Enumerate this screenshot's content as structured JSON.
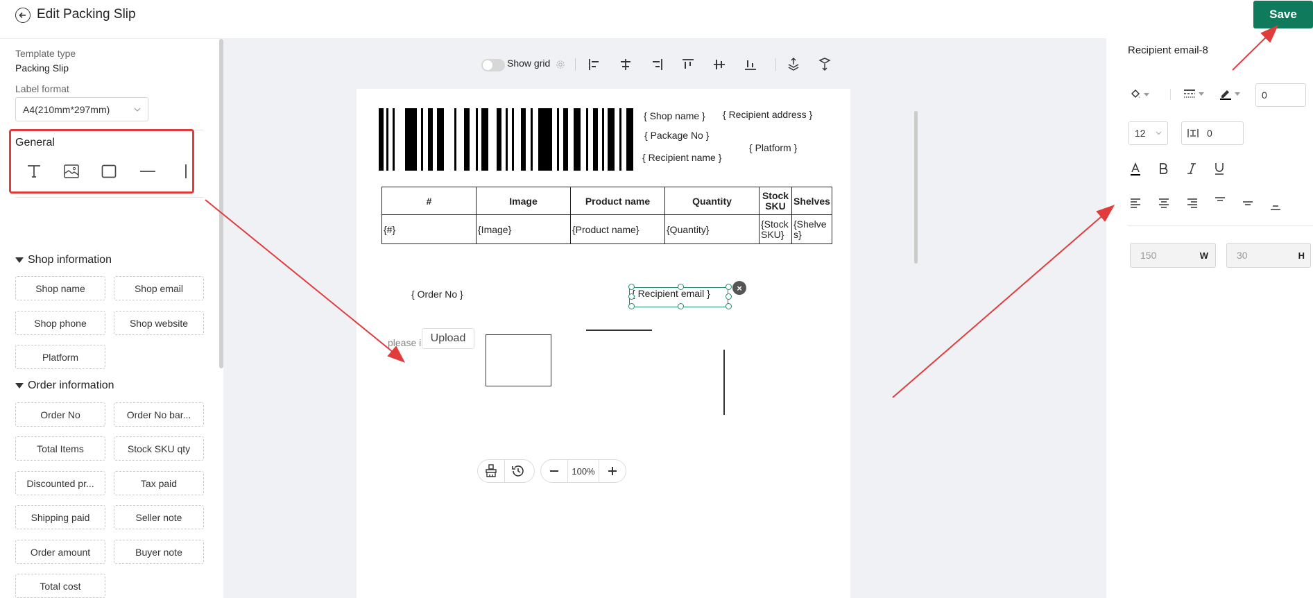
{
  "header": {
    "back_icon": "arrow-left-icon",
    "title": "Edit Packing Slip",
    "save_label": "Save",
    "save_color": "#0f7a5c"
  },
  "left_panel": {
    "template_type_label": "Template type",
    "template_type_value": "Packing Slip",
    "label_format_label": "Label format",
    "label_format_value": "A4(210mm*297mm)",
    "general": {
      "title": "General",
      "tools": [
        "text-tool-icon",
        "image-tool-icon",
        "rectangle-tool-icon",
        "horizontal-line-tool-icon",
        "vertical-line-tool-icon"
      ]
    },
    "shop_information": {
      "title": "Shop information",
      "items": [
        "Shop name",
        "Shop email",
        "Shop phone",
        "Shop website",
        "Platform"
      ]
    },
    "order_information": {
      "title": "Order information",
      "items": [
        "Order No",
        "Order No bar...",
        "Total Items",
        "Stock SKU qty",
        "Discounted pr...",
        "Tax paid",
        "Shipping paid",
        "Seller note",
        "Order amount",
        "Buyer note",
        "Total cost"
      ]
    }
  },
  "toolbar": {
    "show_grid_label": "Show grid",
    "show_grid_on": false,
    "icons": [
      "settings-icon",
      "align-left-icon",
      "align-center-horizontal-icon",
      "align-right-icon",
      "align-top-icon",
      "align-middle-vertical-icon",
      "align-bottom-icon",
      "bring-forward-icon",
      "send-backward-icon"
    ]
  },
  "paper": {
    "fields": {
      "shop_name": "{ Shop name }",
      "recipient_address": "{ Recipient address }",
      "package_no": "{ Package No }",
      "platform": "{ Platform }",
      "recipient_name": "{ Recipient name }",
      "order_no": "{ Order No }",
      "recipient_email": "{ Recipient email }",
      "text_placeholder": "please input text",
      "upload_label": "Upload"
    },
    "table": {
      "headers": [
        "#",
        "Image",
        "Product name",
        "Quantity",
        "Stock SKU",
        "Shelves"
      ],
      "row": [
        "{#}",
        "{Image}",
        "{Product name}",
        "{Quantity}",
        "{Stock SKU}",
        "{Shelves}"
      ]
    }
  },
  "bottom_controls": {
    "clear_icon": "broom-icon",
    "history_icon": "history-icon",
    "zoom_out_icon": "minus-icon",
    "zoom_level": "100%",
    "zoom_in_icon": "plus-icon"
  },
  "right_panel": {
    "element_title": "Recipient email-8",
    "fill_icon": "fill-bucket-icon",
    "border_style_icon": "border-style-icon",
    "border_color_icon": "pen-color-icon",
    "border_width": "0",
    "font_size": "12",
    "letter_spacing_icon": "letter-spacing-icon",
    "letter_spacing": "0",
    "text_icons": [
      "font-color-icon",
      "bold-icon",
      "italic-icon",
      "underline-icon"
    ],
    "align_icons": [
      "text-align-left-icon",
      "text-align-center-icon",
      "text-align-right-icon",
      "valign-top-icon",
      "valign-middle-icon",
      "valign-bottom-icon"
    ],
    "width": "150",
    "width_unit": "W",
    "height": "30",
    "height_unit": "H"
  },
  "annotation_color": "#e03c3c"
}
